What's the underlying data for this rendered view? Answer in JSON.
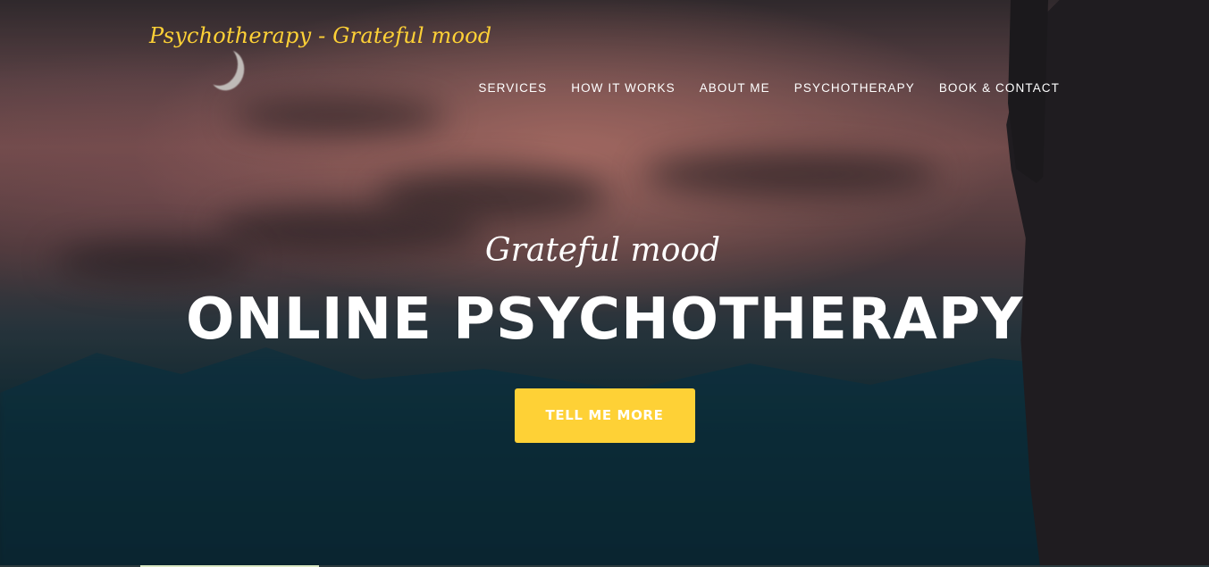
{
  "brand": {
    "name": "Psychotherapy - Grateful mood"
  },
  "nav": {
    "items": [
      {
        "label": "SERVICES"
      },
      {
        "label": "HOW IT WORKS"
      },
      {
        "label": "ABOUT ME"
      },
      {
        "label": "PSYCHOTHERAPY"
      },
      {
        "label": "BOOK & CONTACT"
      }
    ]
  },
  "hero": {
    "lead": "Grateful mood",
    "heading": "ONLINE PSYCHOTHERAPY",
    "cta_label": "TELL ME MORE"
  },
  "colors": {
    "accent": "#fed136",
    "text": "#ffffff"
  }
}
